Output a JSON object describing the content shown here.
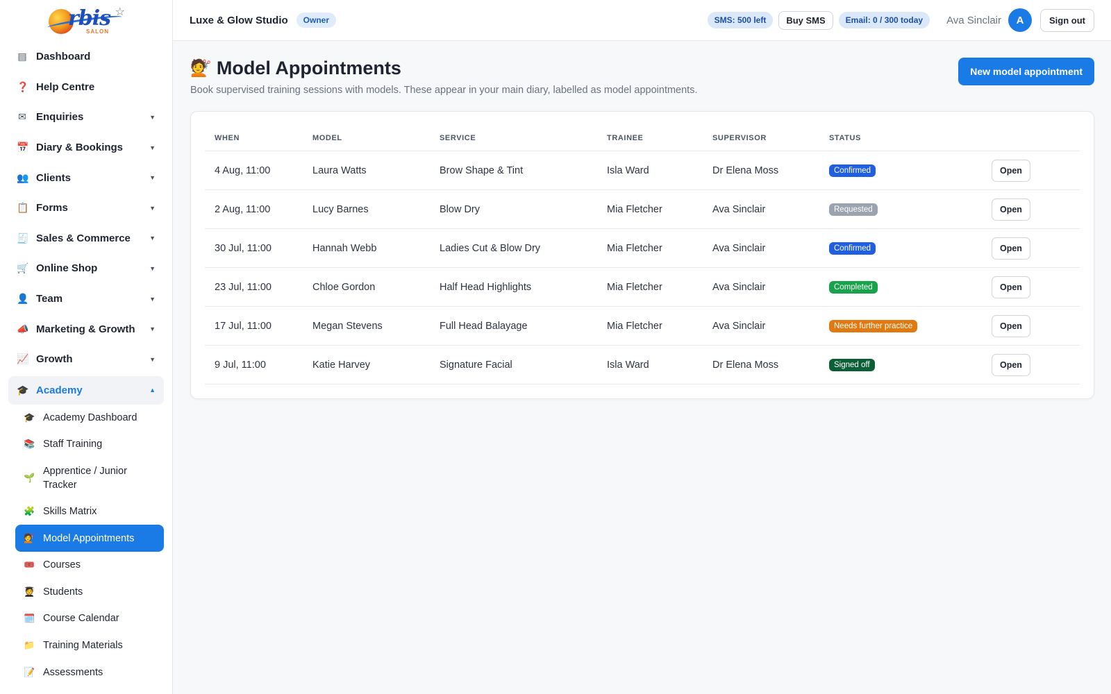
{
  "brand": {
    "logo_text": "rbis",
    "logo_sub": "SALON"
  },
  "sidebar": {
    "items": [
      {
        "label": "Dashboard",
        "icon": "dashboard-icon",
        "glyph": "▤",
        "expandable": false
      },
      {
        "label": "Help Centre",
        "icon": "question-icon",
        "glyph": "❓",
        "expandable": false
      },
      {
        "label": "Enquiries",
        "icon": "envelope-icon",
        "glyph": "✉",
        "expandable": true
      },
      {
        "label": "Diary & Bookings",
        "icon": "calendar-icon",
        "glyph": "📅",
        "expandable": true
      },
      {
        "label": "Clients",
        "icon": "people-icon",
        "glyph": "👥",
        "expandable": true
      },
      {
        "label": "Forms",
        "icon": "clipboard-icon",
        "glyph": "📋",
        "expandable": true
      },
      {
        "label": "Sales & Commerce",
        "icon": "receipt-icon",
        "glyph": "🧾",
        "expandable": true
      },
      {
        "label": "Online Shop",
        "icon": "cart-icon",
        "glyph": "🛒",
        "expandable": true
      },
      {
        "label": "Team",
        "icon": "person-icon",
        "glyph": "👤",
        "expandable": true
      },
      {
        "label": "Marketing & Growth",
        "icon": "megaphone-icon",
        "glyph": "📣",
        "expandable": true
      },
      {
        "label": "Growth",
        "icon": "chart-up-icon",
        "glyph": "📈",
        "expandable": true
      }
    ],
    "academy": {
      "label": "Academy",
      "icon": "graduation-cap-icon",
      "glyph": "🎓",
      "subitems": [
        {
          "label": "Academy Dashboard",
          "icon": "graduation-cap-icon",
          "glyph": "🎓"
        },
        {
          "label": "Staff Training",
          "icon": "books-icon",
          "glyph": "📚"
        },
        {
          "label": "Apprentice / Junior Tracker",
          "icon": "seedling-icon",
          "glyph": "🌱"
        },
        {
          "label": "Skills Matrix",
          "icon": "puzzle-icon",
          "glyph": "🧩"
        },
        {
          "label": "Model Appointments",
          "icon": "haircut-icon",
          "glyph": "💇",
          "active": true
        },
        {
          "label": "Courses",
          "icon": "ticket-icon",
          "glyph": "🎟️"
        },
        {
          "label": "Students",
          "icon": "student-icon",
          "glyph": "🧑‍🎓"
        },
        {
          "label": "Course Calendar",
          "icon": "calendar-icon",
          "glyph": "🗓️"
        },
        {
          "label": "Training Materials",
          "icon": "folder-icon",
          "glyph": "📁"
        },
        {
          "label": "Assessments",
          "icon": "memo-icon",
          "glyph": "📝"
        }
      ]
    }
  },
  "header": {
    "studio": "Luxe & Glow Studio",
    "role": "Owner",
    "sms": "SMS: 500 left",
    "buy_sms": "Buy SMS",
    "email": "Email: 0 / 300 today",
    "user": "Ava Sinclair",
    "avatar": "A",
    "sign_out": "Sign out"
  },
  "page": {
    "emoji": "💇",
    "title": "Model Appointments",
    "subtitle": "Book supervised training sessions with models. These appear in your main diary, labelled as model appointments.",
    "new_button": "New model appointment"
  },
  "table": {
    "columns": [
      "WHEN",
      "MODEL",
      "SERVICE",
      "TRAINEE",
      "SUPERVISOR",
      "STATUS",
      ""
    ],
    "open_label": "Open",
    "rows": [
      {
        "when": "4 Aug, 11:00",
        "model": "Laura Watts",
        "service": "Brow Shape & Tint",
        "trainee": "Isla Ward",
        "supervisor": "Dr Elena Moss",
        "status": "Confirmed",
        "status_color": "#1f5fe0"
      },
      {
        "when": "2 Aug, 11:00",
        "model": "Lucy Barnes",
        "service": "Blow Dry",
        "trainee": "Mia Fletcher",
        "supervisor": "Ava Sinclair",
        "status": "Requested",
        "status_color": "#9ca3af"
      },
      {
        "when": "30 Jul, 11:00",
        "model": "Hannah Webb",
        "service": "Ladies Cut & Blow Dry",
        "trainee": "Mia Fletcher",
        "supervisor": "Ava Sinclair",
        "status": "Confirmed",
        "status_color": "#1f5fe0"
      },
      {
        "when": "23 Jul, 11:00",
        "model": "Chloe Gordon",
        "service": "Half Head Highlights",
        "trainee": "Mia Fletcher",
        "supervisor": "Ava Sinclair",
        "status": "Completed",
        "status_color": "#16a34a"
      },
      {
        "when": "17 Jul, 11:00",
        "model": "Megan Stevens",
        "service": "Full Head Balayage",
        "trainee": "Mia Fletcher",
        "supervisor": "Ava Sinclair",
        "status": "Needs further practice",
        "status_color": "#e07a10"
      },
      {
        "when": "9 Jul, 11:00",
        "model": "Katie Harvey",
        "service": "Signature Facial",
        "trainee": "Isla Ward",
        "supervisor": "Dr Elena Moss",
        "status": "Signed off",
        "status_color": "#0b5e36"
      }
    ]
  }
}
